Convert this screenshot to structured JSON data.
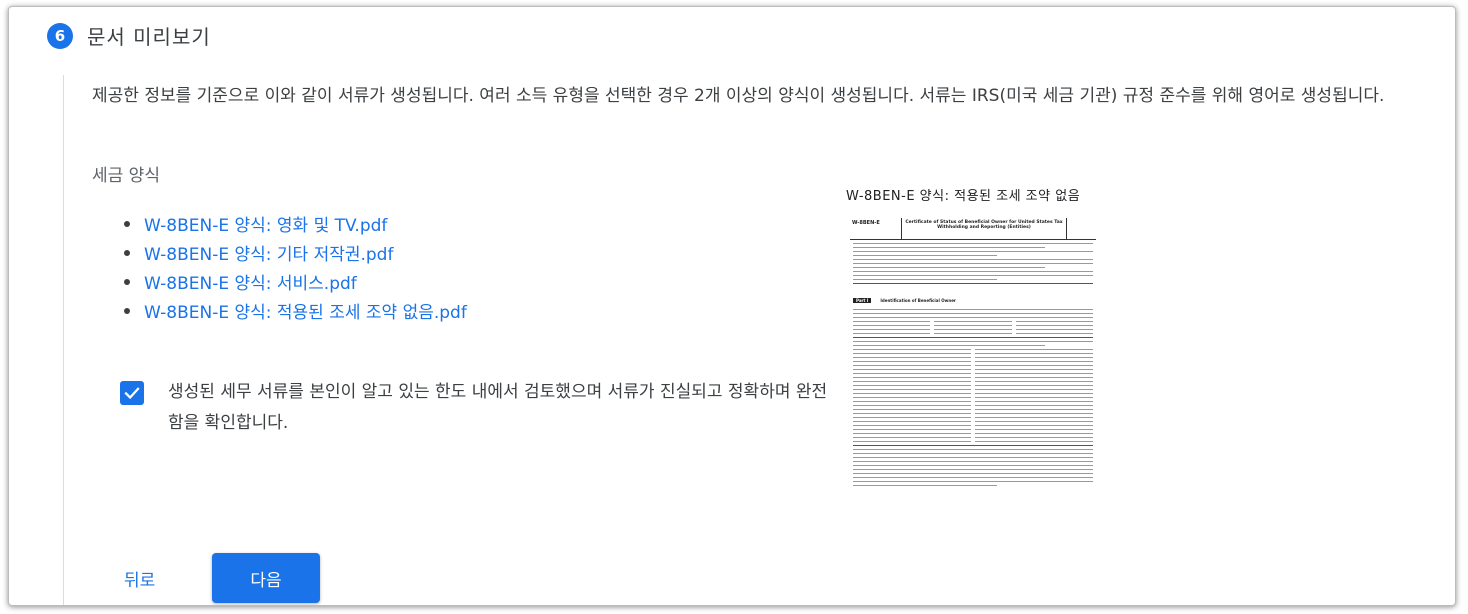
{
  "step": {
    "number": "6",
    "title": "문서 미리보기"
  },
  "description": "제공한 정보를 기준으로 이와 같이 서류가 생성됩니다. 여러 소득 유형을 선택한 경우 2개 이상의 양식이 생성됩니다. 서류는 IRS(미국 세금 기관) 규정 준수를 위해 영어로 생성됩니다.",
  "forms_label": "세금 양식",
  "files": [
    "W-8BEN-E 양식: 영화 및 TV.pdf",
    "W-8BEN-E 양식: 기타 저작권.pdf",
    "W-8BEN-E 양식: 서비스.pdf",
    "W-8BEN-E 양식: 적용된 조세 조약 없음.pdf"
  ],
  "confirmation": {
    "checked": true,
    "text": "생성된 세무 서류를 본인이 알고 있는 한도 내에서 검토했으며 서류가 진실되고 정확하며 완전함을 확인합니다."
  },
  "preview": {
    "title": "W-8BEN-E 양식: 적용된 조세 조약 없음",
    "doc_form": "W-8BEN-E",
    "doc_title": "Certificate of Status of Beneficial Owner for United States Tax Withholding and Reporting (Entities)",
    "doc_part": "Part I",
    "doc_part_title": "Identification of Beneficial Owner"
  },
  "buttons": {
    "back": "뒤로",
    "next": "다음"
  },
  "colors": {
    "accent": "#1a73e8"
  }
}
